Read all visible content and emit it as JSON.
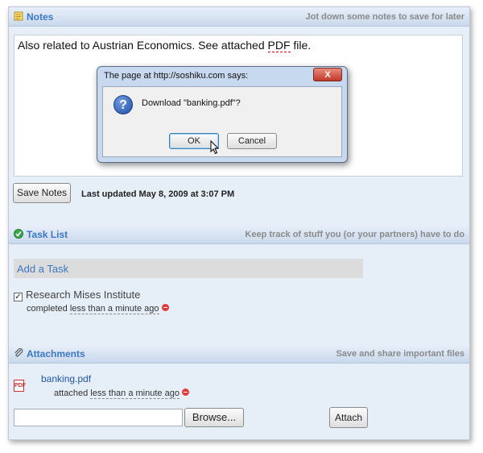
{
  "notes": {
    "title": "Notes",
    "hint": "Jot down some notes to save for later",
    "text_before": "Also related to Austrian Economics.  See attached ",
    "text_link": "PDF",
    "text_after": " file.",
    "save_label": "Save Notes",
    "last_updated": "Last updated May 8, 2009 at 3:07 PM"
  },
  "dialog": {
    "title": "The page at http://soshiku.com says:",
    "message": "Download \"banking.pdf\"?",
    "ok_label": "OK",
    "cancel_label": "Cancel",
    "close_label": "X"
  },
  "tasks": {
    "title": "Task List",
    "hint": "Keep track of stuff you (or your partners) have to do",
    "add_label": "Add a Task",
    "items": [
      {
        "label": "Research Mises Institute",
        "checked": true,
        "status_prefix": "completed ",
        "status_time": "less than a minute ago"
      }
    ]
  },
  "attachments": {
    "title": "Attachments",
    "hint": "Save and share important files",
    "files": [
      {
        "name": "banking.pdf",
        "meta_prefix": "attached ",
        "meta_time": "less than a minute ago"
      }
    ],
    "browse_label": "Browse...",
    "attach_label": "Attach"
  },
  "icons": {
    "notes": "notepad-icon",
    "tasks": "green-check-icon",
    "attachments": "paperclip-icon",
    "dialog": "question-icon",
    "file": "pdf-file-icon",
    "delete": "delete-icon"
  },
  "colors": {
    "accent": "#3b78c4",
    "panel_bg": "#e6eef8",
    "delete": "#e03a3a"
  }
}
